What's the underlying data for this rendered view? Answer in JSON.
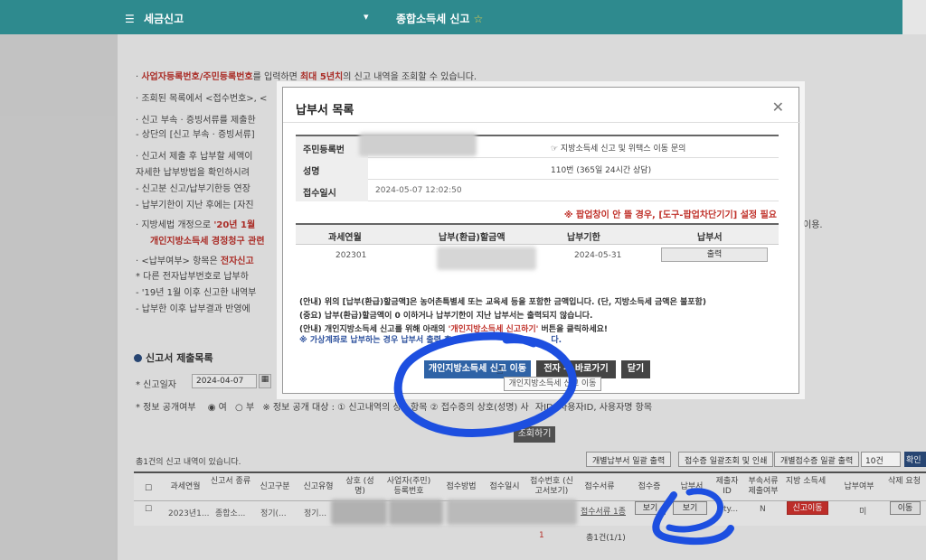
{
  "topbar": {
    "menu_icon": "hamburger-icon",
    "menu_label": "세금신고",
    "chevron": "▾",
    "current_label": "종합소득세 신고",
    "star_icon": "star-icon"
  },
  "background_notes": {
    "line1_prefix": "· ",
    "line1_red": "사업자등록번호/주민등록번호",
    "line1_mid": "를 입력하면 ",
    "line1_red2": "최대 5년치",
    "line1_end": "의 신고 내역을 조회할 수 있습니다.",
    "line2": "· 조회된 목록에서 <접수번호>, <",
    "line3": "· 신고 부속 · 증빙서류를 제출한",
    "line4": "  - 상단의 [신고 부속 · 증빙서류]",
    "line5": "· 신고서 제출 후 납부할 세액이",
    "line6": "  자세한 납부방법을 확인하시려",
    "line7": "  - 신고분 신고/납부기한등 연장",
    "line8": "  - 납부기한이 지난 후에는 [자진",
    "line9_prefix": "· 지방세법 개정으로 ",
    "line9_red": "'20년 1월",
    "line10_red": "개인지방소득세 경정청구 관련",
    "line11_prefix": "· <납부여부> 항목은 ",
    "line11_red": "전자신고",
    "line12": "  * 다른 전자납부번호로 납부하",
    "line13": "  - '19년 1월 이후 신고한 내역부",
    "line14": "  - 납부한 이후 납부결과 반영에",
    "right_fragment": "이용."
  },
  "list_section": {
    "title": "신고서 제출목록",
    "date_label": "* 신고일자",
    "date_value": "2024-04-07",
    "calendar_icon": "calendar-icon",
    "disclosure_label": "* 정보 공개여부",
    "radio_yes": "여",
    "radio_no": "부",
    "disclosure_note": "※ 정보 공개 대상 : ① 신고내역의 상",
    "disclosure_note2": "항목 ② 접수증의 상호(성명) 사",
    "disclosure_note3": "자ID, 사용자ID, 사용자명 항목",
    "search_button": "조회하기",
    "count_text": "총1건의 신고 내역이 있습니다.",
    "btn_batch_pay": "개별납부서 일괄 출력",
    "btn_batch_receipt": "접수증 일괄조회 및 인쇄",
    "btn_batch_receipt2": "개별접수증 일괄 출력",
    "page_size": "10건",
    "page_size_btn": "확인",
    "columns": [
      "과세연월",
      "신고서 종류",
      "신고구분",
      "신고유형",
      "상호 (성명)",
      "사업자(주민) 등록번호",
      "접수방법",
      "접수일시",
      "접수번호 (신고서보기)",
      "접수서류",
      "접수증",
      "납부서",
      "제출자 ID",
      "부속서류 제출여부",
      "지방 소득세",
      "납부여부",
      "삭제 요청"
    ],
    "row": {
      "period": "2023년1...",
      "type": "종합소...",
      "category": "정기(...",
      "kind": "정기...",
      "documents": "접수서류 1종",
      "receipt_btn": "보기",
      "pay_btn": "보기",
      "submitter": "ty...",
      "attached": "N",
      "local_tax_btn": "신고이동",
      "paid": "미",
      "delete_btn": "이동"
    },
    "pager": "1",
    "pager_count": "총1건(1/1)"
  },
  "modal": {
    "title": "납부서 목록",
    "close_icon": "close-icon",
    "info": {
      "id_label": "주민등록번",
      "name_label": "성명",
      "date_label": "접수일시",
      "date_value": "2024-05-07 12:02:50",
      "right1": "☞ 지방소득세 신고 및 위택스 이동 문의",
      "right2": "110번 (365일 24시간 상담)"
    },
    "popup_warning": "※ 팝업창이 안 뜰 경우, [도구-팝업차단기기] 설정 필요",
    "table": {
      "headers": [
        "과세연월",
        "납부(환급)할금액",
        "납부기한",
        "납부서"
      ],
      "row": {
        "period": "202301",
        "due": "2024-05-31",
        "print": "출력"
      }
    },
    "notice1": "(안내) 위의 [납부(환급)할금액]은 농어촌특별세 또는 교육세 등을 포함한 금액입니다. (단, 지방소득세 금액은 불포함)",
    "notice2": "(중요) 납부(환급)할금액이 0 이하거나 납부기한이 지난 납부서는 출력되지 않습니다.",
    "notice3_a": "(안내) 개인지방소득세 신고를 위해  아래의 ",
    "notice3_b": "'개인지방소득세 신고하기'",
    "notice3_c": "  버튼을 클릭하세요!",
    "notice4": "※ 가상계좌로 납부하는 경우 납부서 출력 후",
    "notice4_end": "다.",
    "btn_local": "개인지방소득세 신고 이동",
    "btn_shortcut": "전자  부 바로가기",
    "btn_close": "닫기",
    "tooltip": "개인지방소득세 신고 이동",
    "cursor_icon": "hand-cursor-icon"
  }
}
